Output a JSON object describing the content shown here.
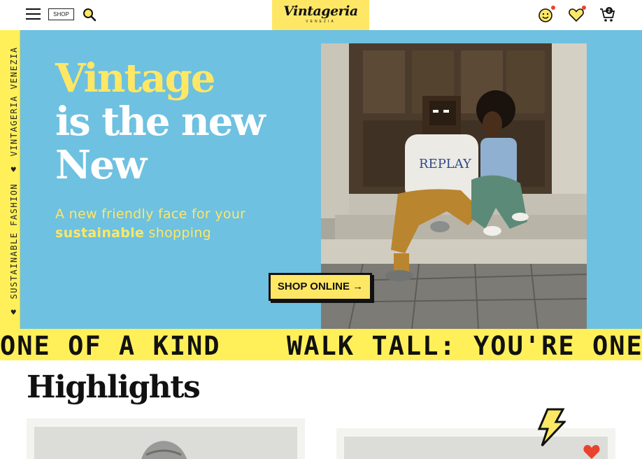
{
  "header": {
    "shop_label": "SHOP",
    "logo": "Vintageria",
    "logo_sub": "VENEZIA",
    "cart_count": "2"
  },
  "side_rail": {
    "text_1": "SUSTAINABLE FASHION",
    "text_2": "VINTAGERIA VENEZIA"
  },
  "hero": {
    "title_line1": "Vintage",
    "title_line2": "is the new",
    "title_line3": "New",
    "subtitle_prefix": "A new friendly face for your",
    "subtitle_bold": "sustainable",
    "subtitle_suffix": " shopping",
    "cta_label": "SHOP ONLINE →"
  },
  "ticker": {
    "items": [
      "ONE OF A KIND",
      "WALK TALL: YOU'RE ONE"
    ]
  },
  "highlights": {
    "title": "Highlights"
  },
  "colors": {
    "accent_yellow": "#ffe766",
    "hero_blue": "#6ec1e0",
    "notification_red": "#e8432d"
  }
}
